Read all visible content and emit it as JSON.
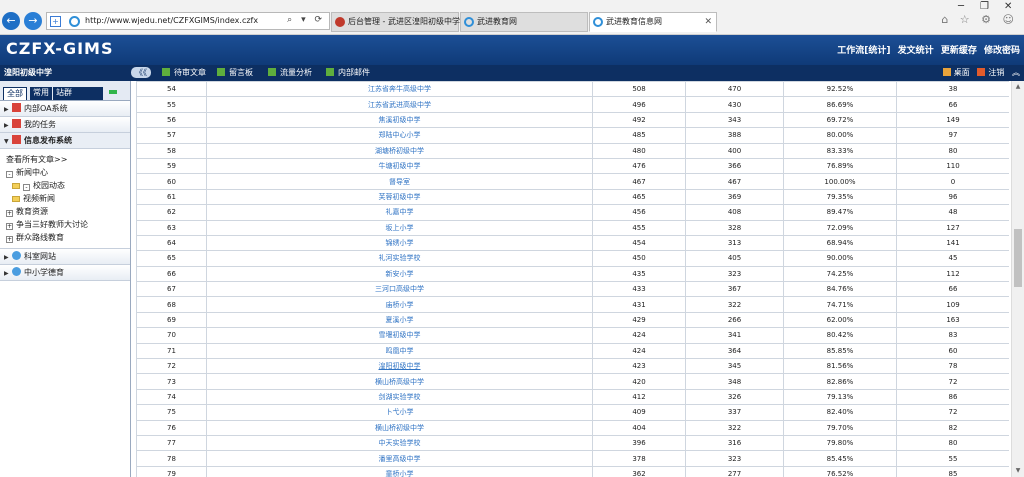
{
  "browser": {
    "url": "http://www.wjedu.net/CZFXGIMS/index.czfx",
    "address_tools": "⌕ ▾ ⟳",
    "tabs": [
      {
        "label": "后台管理 - 武进区湟阳初级中学"
      },
      {
        "label": "武进教育网"
      },
      {
        "label": "武进教育信息网",
        "close": "✕"
      }
    ],
    "window_controls": {
      "minimize": "─",
      "maximize": "❐",
      "close": "✕"
    },
    "right_icons": "⌂ ☆ ⚙ ☺"
  },
  "header": {
    "logo": "CZFX-GIMS",
    "links": [
      "工作流[统计]",
      "发文统计",
      "更新缓存",
      "修改密码"
    ]
  },
  "toolbar": {
    "org": "湟阳初级中学",
    "collapse": "《《",
    "items": [
      "待审文章",
      "留言板",
      "流量分析",
      "内部邮件"
    ],
    "desktop": "桌面",
    "logout": "注销",
    "expand": "︽"
  },
  "sidebar": {
    "tabs": [
      "全部",
      "常用",
      "站群"
    ],
    "sections_top": [
      "内部OA系统",
      "我的任务"
    ],
    "open_section": "信息发布系统",
    "tree": {
      "view_all": "查看所有文章>>",
      "news_center": "新闻中心",
      "campus": "校园动态",
      "video": "视频新闻",
      "resources": "教育资源",
      "teachers": "争当三好教师大讨论",
      "mass_line": "群众路线教育"
    },
    "sections_bottom": [
      "科室网站",
      "中小学德育"
    ]
  },
  "table": {
    "rows": [
      [
        "54",
        "江苏省奔牛高级中学",
        "508",
        "470",
        "92.52%",
        "38"
      ],
      [
        "55",
        "江苏省武进高级中学",
        "496",
        "430",
        "86.69%",
        "66"
      ],
      [
        "56",
        "焦溪初级中学",
        "492",
        "343",
        "69.72%",
        "149"
      ],
      [
        "57",
        "郑陆中心小学",
        "485",
        "388",
        "80.00%",
        "97"
      ],
      [
        "58",
        "湖塘桥初级中学",
        "480",
        "400",
        "83.33%",
        "80"
      ],
      [
        "59",
        "牛塘初级中学",
        "476",
        "366",
        "76.89%",
        "110"
      ],
      [
        "60",
        "督导室",
        "467",
        "467",
        "100.00%",
        "0"
      ],
      [
        "61",
        "芙蓉初级中学",
        "465",
        "369",
        "79.35%",
        "96"
      ],
      [
        "62",
        "礼嘉中学",
        "456",
        "408",
        "89.47%",
        "48"
      ],
      [
        "63",
        "坂上小学",
        "455",
        "328",
        "72.09%",
        "127"
      ],
      [
        "64",
        "锦绣小学",
        "454",
        "313",
        "68.94%",
        "141"
      ],
      [
        "65",
        "礼河实验学校",
        "450",
        "405",
        "90.00%",
        "45"
      ],
      [
        "66",
        "新安小学",
        "435",
        "323",
        "74.25%",
        "112"
      ],
      [
        "67",
        "三河口高级中学",
        "433",
        "367",
        "84.76%",
        "66"
      ],
      [
        "68",
        "庙桥小学",
        "431",
        "322",
        "74.71%",
        "109"
      ],
      [
        "69",
        "夏溪小学",
        "429",
        "266",
        "62.00%",
        "163"
      ],
      [
        "70",
        "雪堰初级中学",
        "424",
        "341",
        "80.42%",
        "83"
      ],
      [
        "71",
        "鸣凰中学",
        "424",
        "364",
        "85.85%",
        "60"
      ],
      [
        "72",
        "湟阳初级中学",
        "423",
        "345",
        "81.56%",
        "78"
      ],
      [
        "73",
        "横山桥高级中学",
        "420",
        "348",
        "82.86%",
        "72"
      ],
      [
        "74",
        "剑湖实验学校",
        "412",
        "326",
        "79.13%",
        "86"
      ],
      [
        "75",
        "卜弋小学",
        "409",
        "337",
        "82.40%",
        "72"
      ],
      [
        "76",
        "横山桥初级中学",
        "404",
        "322",
        "79.70%",
        "82"
      ],
      [
        "77",
        "中天实验学校",
        "396",
        "316",
        "79.80%",
        "80"
      ],
      [
        "78",
        "潘里高级中学",
        "378",
        "323",
        "85.45%",
        "55"
      ],
      [
        "79",
        "童桥小学",
        "362",
        "277",
        "76.52%",
        "85"
      ]
    ]
  },
  "colors": {
    "header": "#1c4f96",
    "toolbar": "#0d2f62",
    "link": "#2f73c4"
  }
}
